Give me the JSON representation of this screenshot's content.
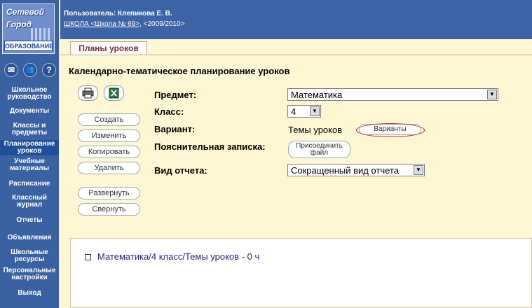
{
  "logo": {
    "line1": "Сетевой",
    "line2": "Город",
    "line3": "ОБРАЗОВАНИЕ"
  },
  "sidebar": {
    "tool_icons": [
      {
        "name": "mail-icon",
        "glyph": "✉"
      },
      {
        "name": "users-icon",
        "glyph": "👥"
      },
      {
        "name": "help-icon",
        "glyph": "?"
      }
    ],
    "items": [
      {
        "label": "Школьное руководство"
      },
      {
        "label": "Документы"
      },
      {
        "label": "Классы и предметы"
      },
      {
        "label": "Планирование уроков",
        "active": true
      },
      {
        "label": "Учебные материалы"
      },
      {
        "label": "Расписание"
      },
      {
        "label": "Классный журнал"
      },
      {
        "label": "Отчеты"
      },
      {
        "label": "Объявления"
      },
      {
        "label": "Школьные ресурсы"
      },
      {
        "label": "Персональные настройки"
      },
      {
        "label": "Выход"
      }
    ]
  },
  "header": {
    "user": "Пользователь: Клепикова Е. В.",
    "school_link": "ШКОЛА <Школа № 69>",
    "year": ", <2009/2010>"
  },
  "tabs": [
    {
      "label": "Планы уроков"
    }
  ],
  "page": {
    "title": "Календарно-тематическое планирование уроков"
  },
  "actions": {
    "create": "Создать",
    "edit": "Изменить",
    "copy": "Копировать",
    "delete": "Удалить",
    "expand": "Развернуть",
    "collapse": "Свернуть",
    "icons": {
      "print": "printer-icon",
      "excel": "excel-icon"
    }
  },
  "form": {
    "subject_label": "Предмет:",
    "subject_value": "Математика",
    "class_label": "Класс:",
    "class_value": "4",
    "variant_label": "Вариант:",
    "variant_value": "Темы уроков",
    "variants_button": "Варианты",
    "note_label": "Пояснительная записка:",
    "attach_button_line1": "Присоединить",
    "attach_button_line2": "файл",
    "report_label": "Вид отчета:",
    "report_value": "Сокращенный вид отчета"
  },
  "tree": {
    "item": "Математика/4 класс/Темы уроков - 0 ч"
  },
  "colors": {
    "sidebar": "#3a62a3",
    "header": "#3c64a6",
    "content_bg": "#fff7d4",
    "highlight_ring": "#cc1f1f"
  }
}
